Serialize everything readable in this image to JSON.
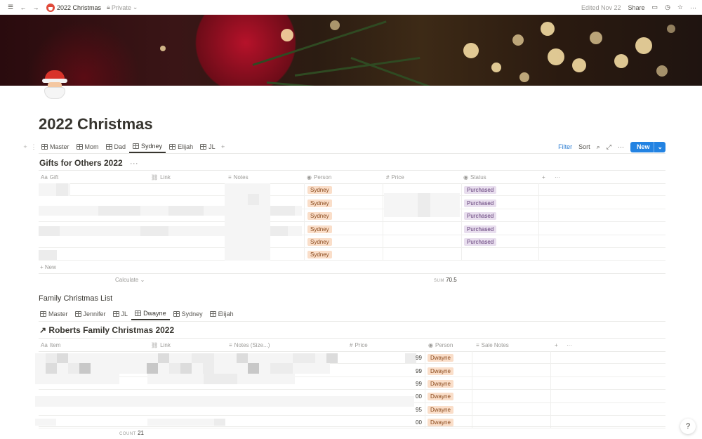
{
  "topbar": {
    "title": "2022 Christmas",
    "privacy": "Private",
    "edited": "Edited Nov 22",
    "share": "Share"
  },
  "page": {
    "title": "2022 Christmas"
  },
  "views": {
    "tabs": [
      "Master",
      "Mom",
      "Dad",
      "Sydney",
      "Elijah",
      "JL"
    ],
    "active": "Sydney",
    "filter": "Filter",
    "sort": "Sort",
    "new": "New"
  },
  "gifts_db": {
    "title": "Gifts for Others 2022",
    "columns": [
      "Gift",
      "Link",
      "Notes",
      "Person",
      "Price",
      "Status"
    ],
    "column_icons": [
      "text-icon",
      "link-icon",
      "notes-icon",
      "person-icon",
      "number-icon",
      "status-icon"
    ],
    "rows": [
      {
        "person": "Sydney",
        "status": "Purchased"
      },
      {
        "person": "Sydney",
        "status": "Purchased"
      },
      {
        "person": "Sydney",
        "status": "Purchased"
      },
      {
        "person": "Sydney",
        "status": "Purchased"
      },
      {
        "person": "Sydney",
        "status": "Purchased"
      },
      {
        "person": "Sydney",
        "status": ""
      }
    ],
    "new_label": "New",
    "calculate": "Calculate",
    "sum_label": "SUM",
    "sum_value": "70.5"
  },
  "family_db": {
    "title": "Family Christmas List",
    "tabs": [
      "Master",
      "Jennifer",
      "JL",
      "Dwayne",
      "Sydney",
      "Elijah"
    ],
    "active": "Dwayne",
    "linked_title": "Roberts Family Christmas 2022",
    "columns": [
      "Item",
      "Link",
      "Notes (Size...)",
      "Price",
      "Person",
      "Sale Notes"
    ],
    "rows": [
      {
        "price_tail": "99",
        "person": "Dwayne"
      },
      {
        "price_tail": "99",
        "person": "Dwayne"
      },
      {
        "price_tail": "99",
        "person": "Dwayne"
      },
      {
        "price_tail": "00",
        "person": "Dwayne"
      },
      {
        "price_tail": "95",
        "person": "Dwayne"
      },
      {
        "price_tail": "00",
        "person": "Dwayne"
      }
    ],
    "count_label": "COUNT",
    "count_value": "21"
  },
  "help": "?",
  "colors": {
    "accent": "#2383e2",
    "person_tag": "#fadec9",
    "status_tag": "#e8deee"
  }
}
